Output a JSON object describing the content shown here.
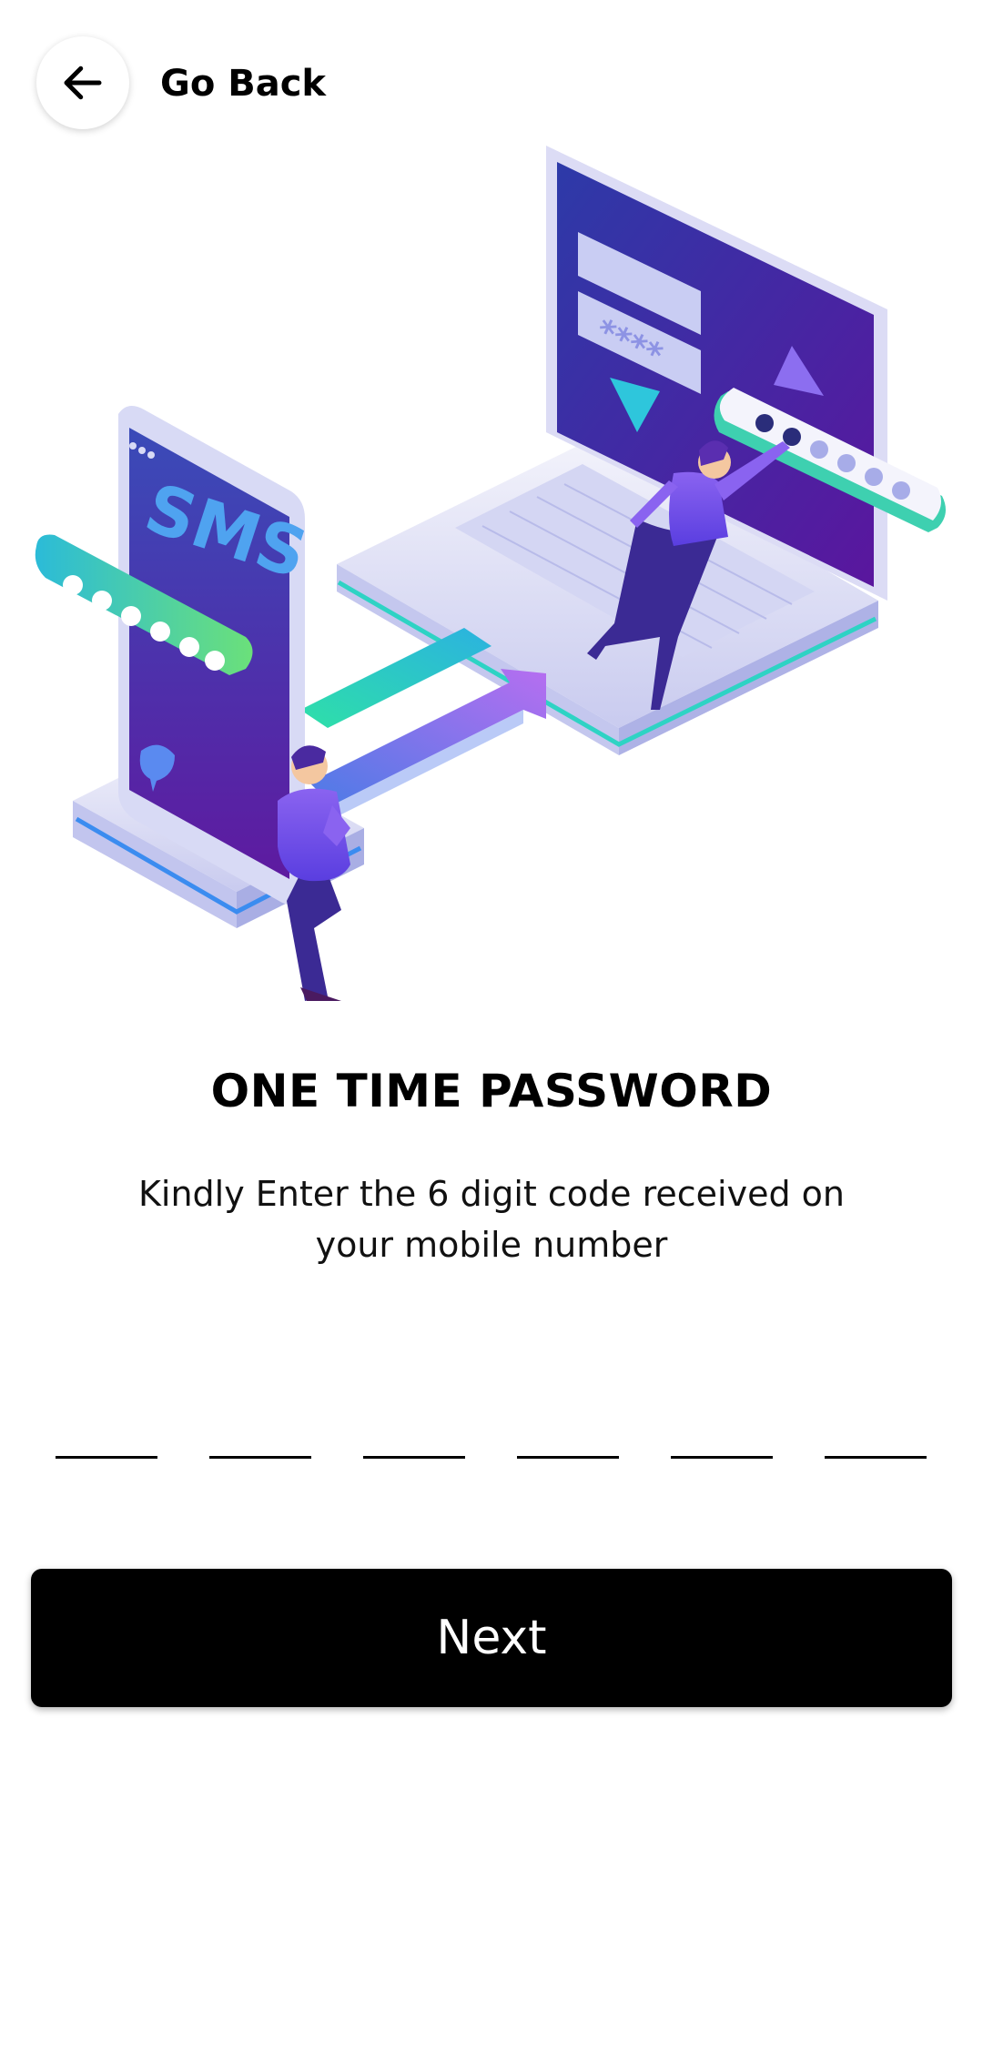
{
  "header": {
    "back_icon": "arrow-left-icon",
    "back_label": "Go Back"
  },
  "illustration": {
    "name": "otp-verification-illustration",
    "phone_text": "SMS"
  },
  "content": {
    "title": "ONE TIME PASSWORD",
    "subtitle": "Kindly Enter the 6 digit code received on your mobile number"
  },
  "otp": {
    "digits": [
      "",
      "",
      "",
      "",
      "",
      ""
    ]
  },
  "actions": {
    "next_label": "Next"
  },
  "colors": {
    "button_bg": "#000000",
    "button_text": "#ffffff",
    "accent_purple": "#5a34c8",
    "accent_teal": "#2bd6b4"
  }
}
